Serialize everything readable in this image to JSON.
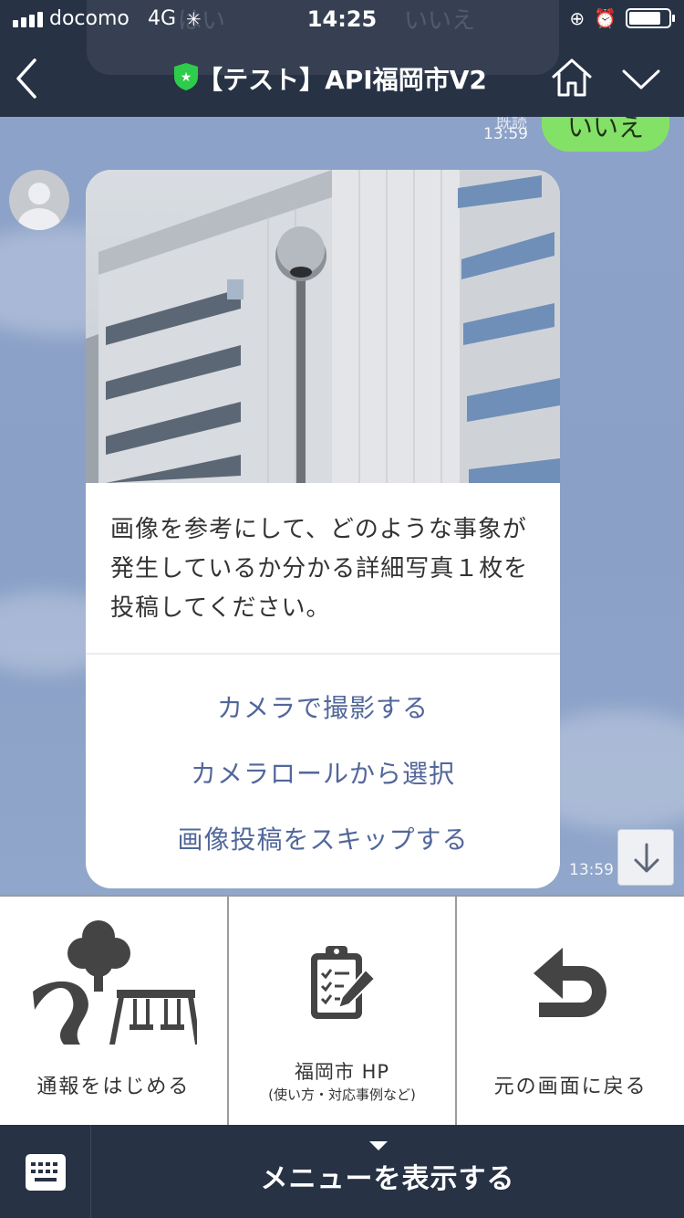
{
  "status_bar": {
    "carrier": "docomo",
    "network": "4G",
    "time": "14:25",
    "icons": [
      "signal-icon",
      "spinner-icon",
      "orientation-lock-icon",
      "alarm-icon",
      "battery-icon"
    ]
  },
  "ghost_overlay": {
    "left_text": "はい",
    "right_text": "いいえ"
  },
  "header": {
    "title": "【テスト】API福岡市V2",
    "icons": [
      "back-chevron-icon",
      "verified-shield-icon",
      "home-icon",
      "chevron-down-icon"
    ],
    "shield_color": "#2ecc4a"
  },
  "chat": {
    "sent_message": {
      "text": "いいえ",
      "read_label": "既読",
      "time": "13:59"
    },
    "received_card": {
      "image_description_icon": "building-photo",
      "body": "画像を参考にして、どのような事象が発生しているか分かる詳細写真１枚を投稿してください。",
      "actions": [
        "カメラで撮影する",
        "カメラロールから選択",
        "画像投稿をスキップする"
      ],
      "time": "13:59"
    }
  },
  "rich_menu": {
    "items": [
      {
        "label": "通報をはじめる",
        "sublabel": "",
        "icon": "park-icon"
      },
      {
        "label": "福岡市 HP",
        "sublabel": "(使い方・対応事例など)",
        "icon": "clipboard-edit-icon"
      },
      {
        "label": "元の画面に戻る",
        "sublabel": "",
        "icon": "return-arrow-icon"
      }
    ]
  },
  "bottom_bar": {
    "menu_toggle_label": "メニューを表示する",
    "keyboard_icon": "keyboard-icon"
  },
  "colors": {
    "header_bg": "#273245",
    "chat_bg": "#8da2c8",
    "sent_bubble": "#84e168",
    "action_link": "#52679a"
  }
}
